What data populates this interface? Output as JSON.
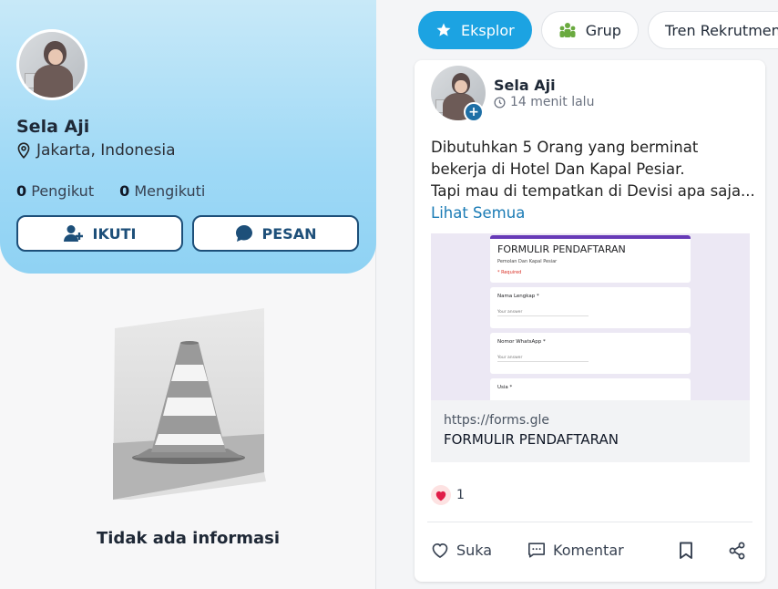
{
  "profile": {
    "name": "Sela Aji",
    "location": "Jakarta, Indonesia",
    "followers_count": "0",
    "followers_label": "Pengikut",
    "following_count": "0",
    "following_label": "Mengikuti",
    "follow_button": "IKUTI",
    "message_button": "PESAN"
  },
  "empty_state": {
    "text": "Tidak ada informasi"
  },
  "tabs": [
    {
      "label": "Eksplor",
      "icon": "star-icon",
      "active": true
    },
    {
      "label": "Grup",
      "icon": "group-icon",
      "active": false
    },
    {
      "label": "Tren Rekrutmen",
      "icon": "",
      "active": false
    }
  ],
  "post": {
    "author": "Sela Aji",
    "time": "14 menit lalu",
    "lines": [
      "Dibutuhkan 5 Orang yang berminat",
      "bekerja di Hotel Dan Kapal Pesiar.",
      "Tapi mau di tempatkan di Devisi apa saja..."
    ],
    "see_all": "Lihat Semua",
    "form_preview": {
      "title": "FORMULIR PENDAFTARAN",
      "subtitle": "Pemolan Dan Kapal Pesiar",
      "required": "* Required",
      "questions": [
        {
          "label": "Nama Lengkap *",
          "answer": "Your answer"
        },
        {
          "label": "Nomor WhatsApp *",
          "answer": "Your answer"
        },
        {
          "label": "Usia *",
          "answer": ""
        }
      ]
    },
    "link_url": "https://forms.gle",
    "link_title": "FORMULIR PENDAFTARAN",
    "like_count": "1",
    "actions": {
      "like": "Suka",
      "comment": "Komentar"
    }
  },
  "colors": {
    "accent": "#1ca3e2",
    "button_border": "#1d4f79",
    "link": "#1a7bb5",
    "card_gradient_top": "#c8e9f8",
    "card_gradient_bottom": "#8fd2f3"
  }
}
